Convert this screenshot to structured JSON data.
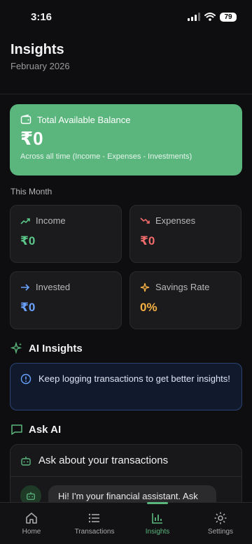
{
  "status": {
    "time": "3:16",
    "battery": "79"
  },
  "header": {
    "title": "Insights",
    "subtitle": "February 2026"
  },
  "balance": {
    "label": "Total Available Balance",
    "amount": "₹0",
    "note": "Across all time (Income - Expenses - Investments)"
  },
  "month": {
    "label": "This Month",
    "cards": [
      {
        "label": "Income",
        "value": "₹0",
        "color": "#5bc88a"
      },
      {
        "label": "Expenses",
        "value": "₹0",
        "color": "#f06b6b"
      },
      {
        "label": "Invested",
        "value": "₹0",
        "color": "#6aa2ff"
      },
      {
        "label": "Savings Rate",
        "value": "0%",
        "color": "#f5b043"
      }
    ]
  },
  "ai": {
    "title": "AI Insights",
    "message": "Keep logging transactions to get better insights!"
  },
  "ask": {
    "title": "Ask AI",
    "card_title": "Ask about your transactions",
    "bot_message": "Hi! I'm your financial assistant. Ask"
  },
  "tabs": [
    {
      "label": "Home",
      "icon": "home-icon"
    },
    {
      "label": "Transactions",
      "icon": "list-icon"
    },
    {
      "label": "Insights",
      "icon": "chart-icon"
    },
    {
      "label": "Settings",
      "icon": "gear-icon"
    }
  ],
  "colors": {
    "accent": "#5bb67e",
    "background": "#0e0e10",
    "card": "#1b1b1d"
  }
}
